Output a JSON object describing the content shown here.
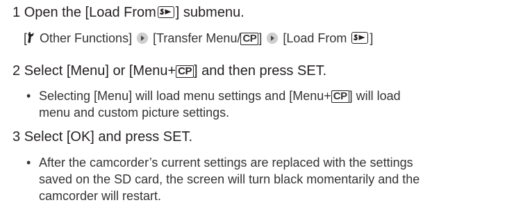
{
  "colors": {
    "text": "#231f20",
    "secondary_text": "#333333",
    "arrow_fill": "#cfcfcf"
  },
  "step1": {
    "number": "1",
    "title_before": "Open the [Load From",
    "title_after": "] submenu.",
    "path": {
      "open1": "[",
      "seg1": "Other Functions]",
      "seg2": "[Transfer Menu/",
      "seg2_close": "]",
      "seg3": "[Load From",
      "seg3_close": "]"
    }
  },
  "step2": {
    "number": "2",
    "title_before": "Select [Menu] or [Menu+",
    "title_after": "] and then press SET.",
    "bullet": {
      "line1_before": "Selecting [Menu] will load menu settings and [Menu+",
      "line1_after": "] will load",
      "line2": "menu and custom picture settings."
    }
  },
  "step3": {
    "number": "3",
    "title": "Select [OK] and press SET.",
    "bullet": {
      "line1": "After the camcorder’s current settings are replaced with the settings",
      "line2": "saved on the SD card, the screen will turn black momentarily and the",
      "line3": "camcorder will restart."
    }
  },
  "icons": {
    "cp_label": "CP",
    "bullet_char": "•",
    "wrench": "wrench-icon",
    "arrow": "arrow-right-icon",
    "sd": "sd-card-icon"
  }
}
